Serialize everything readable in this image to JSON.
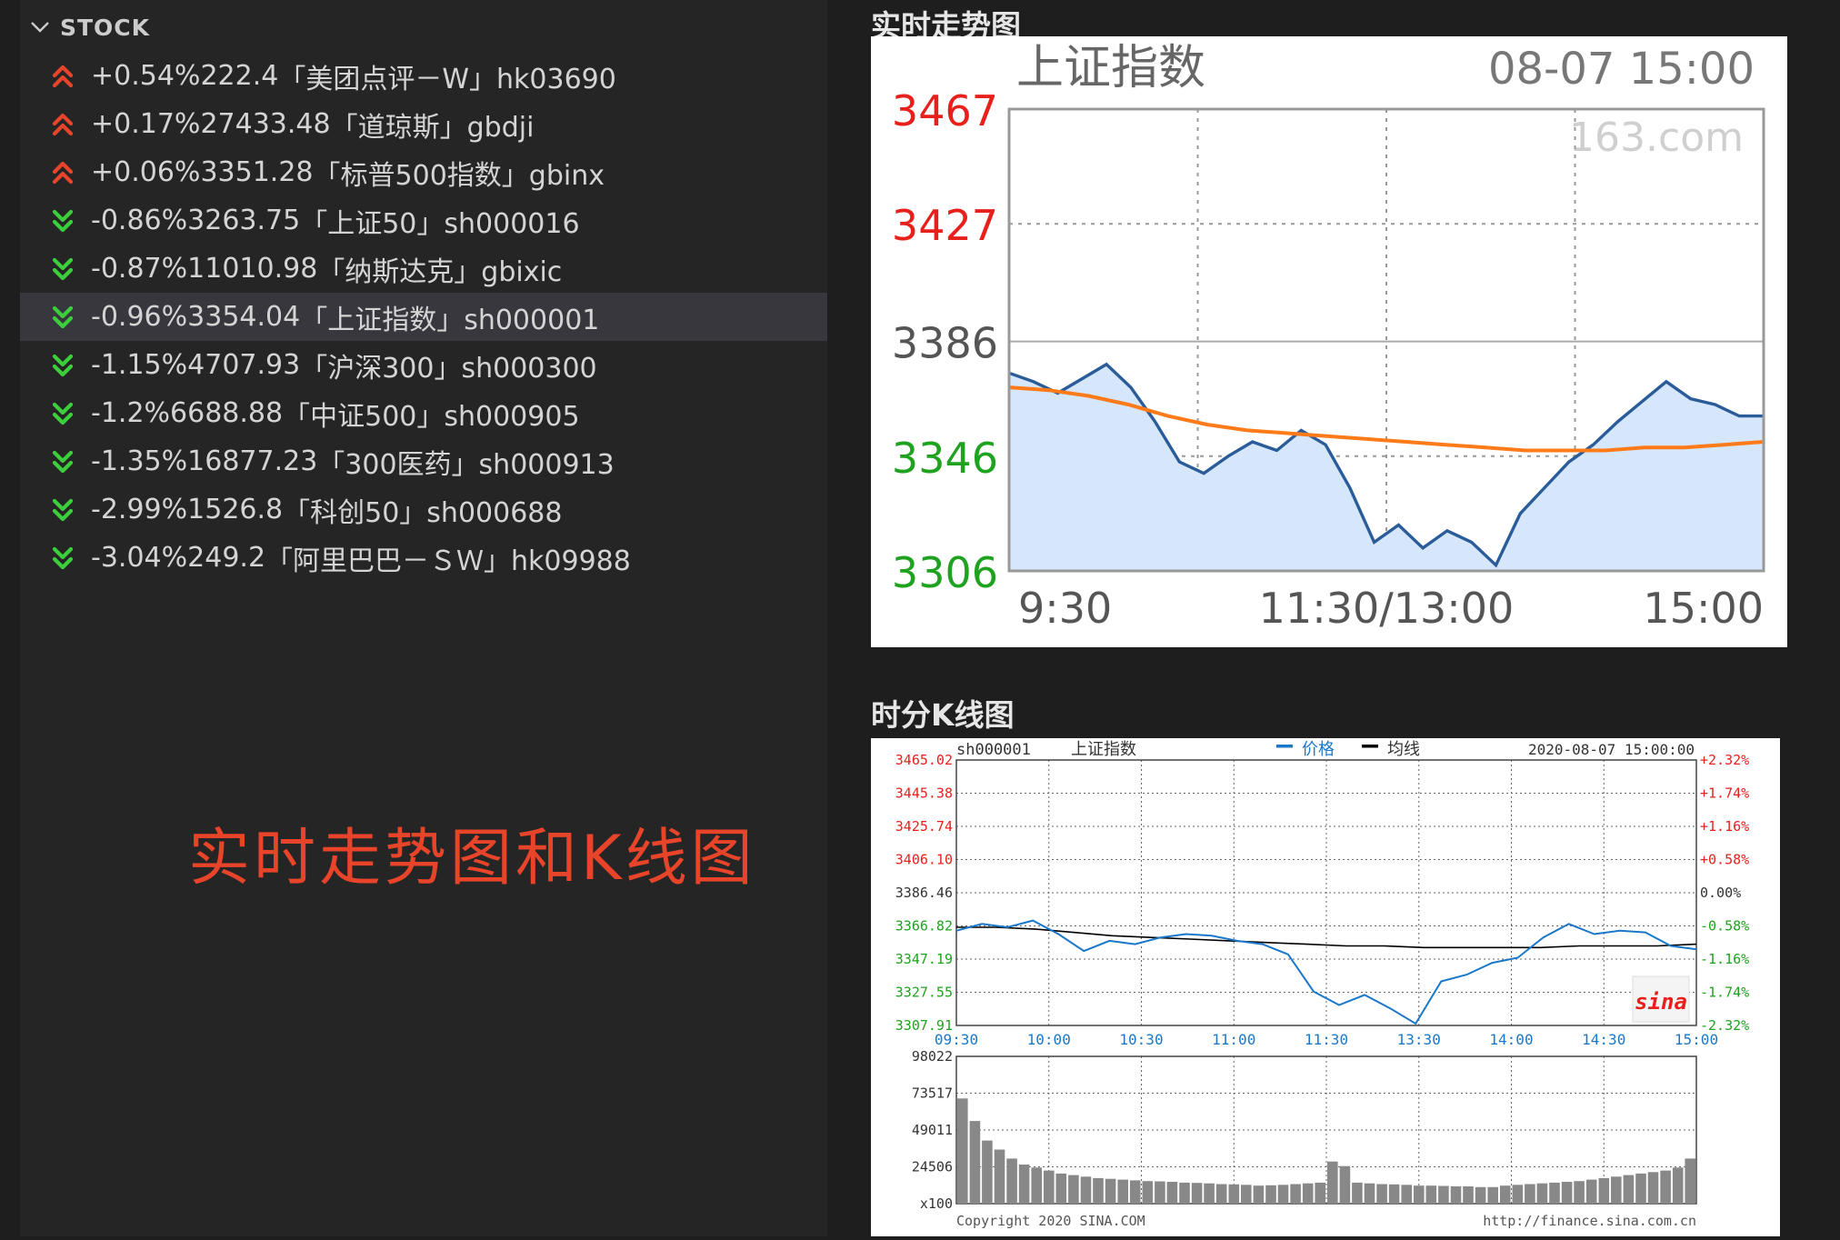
{
  "sidebar": {
    "section_title": "STOCK",
    "stocks": [
      {
        "direction": "up",
        "change": "+0.54%",
        "price": "222.4",
        "name": "「美团点评－W」hk03690"
      },
      {
        "direction": "up",
        "change": "+0.17%",
        "price": "27433.48",
        "name": "「道琼斯」gbdji"
      },
      {
        "direction": "up",
        "change": "+0.06%",
        "price": "3351.28",
        "name": "「标普500指数」gbinx"
      },
      {
        "direction": "down",
        "change": "-0.86%",
        "price": "3263.75",
        "name": "「上证50」sh000016"
      },
      {
        "direction": "down",
        "change": "-0.87%",
        "price": "11010.98",
        "name": "「纳斯达克」gbixic"
      },
      {
        "direction": "down",
        "change": "-0.96%",
        "price": "3354.04",
        "name": "「上证指数」sh000001",
        "selected": true
      },
      {
        "direction": "down",
        "change": "-1.15%",
        "price": "4707.93",
        "name": "「沪深300」sh000300"
      },
      {
        "direction": "down",
        "change": "-1.2%",
        "price": "6688.88",
        "name": "「中证500」sh000905"
      },
      {
        "direction": "down",
        "change": "-1.35%",
        "price": "16877.23",
        "name": "「300医药」sh000913"
      },
      {
        "direction": "down",
        "change": "-2.99%",
        "price": "1526.8",
        "name": "「科创50」sh000688"
      },
      {
        "direction": "down",
        "change": "-3.04%",
        "price": "249.2",
        "name": "「阿里巴巴－ＳＷ」hk09988"
      }
    ]
  },
  "overlay_title": "实时走势图和K线图",
  "colors": {
    "up": "#e8442a",
    "down": "#3ccf3c",
    "accent_red": "#e8442a",
    "grid_orange": "#ff7a18",
    "line_blue": "#2a5c9a",
    "fill_blue": "#d6e6fb"
  },
  "realtime": {
    "title": "实时走势图",
    "index_name": "上证指数",
    "datetime": "08-07 15:00",
    "watermark": "163.com",
    "y_labels": [
      "3467",
      "3427",
      "3386",
      "3346",
      "3306"
    ],
    "x_labels": [
      "9:30",
      "11:30/13:00",
      "15:00"
    ]
  },
  "kline": {
    "title": "时分K线图",
    "code": "sh000001",
    "name": "上证指数",
    "legend_price": "价格",
    "legend_avg": "均线",
    "datetime": "2020-08-07 15:00:00",
    "price_labels": [
      "3465.02",
      "3445.38",
      "3425.74",
      "3406.10",
      "3386.46",
      "3366.82",
      "3347.19",
      "3327.55",
      "3307.91"
    ],
    "pct_labels": [
      "+2.32%",
      "+1.74%",
      "+1.16%",
      "+0.58%",
      "0.00%",
      "-0.58%",
      "-1.16%",
      "-1.74%",
      "-2.32%"
    ],
    "time_labels": [
      "09:30",
      "10:00",
      "10:30",
      "11:00",
      "11:30",
      "13:30",
      "14:00",
      "14:30",
      "15:00"
    ],
    "volume_labels": [
      "98022",
      "73517",
      "49011",
      "24506",
      "x100"
    ],
    "logo": "sina",
    "copyright": "Copyright 2020 SINA.COM",
    "url": "http://finance.sina.com.cn"
  },
  "chart_data": [
    {
      "type": "line",
      "title": "上证指数",
      "x": [
        "9:30",
        "11:30/13:00",
        "15:00"
      ],
      "ylim": [
        3306,
        3467
      ],
      "series": [
        {
          "values": [
            3375,
            3372,
            3368,
            3373,
            3378,
            3370,
            3358,
            3344,
            3340,
            3346,
            3351,
            3348,
            3355,
            3350,
            3335,
            3316,
            3322,
            3314,
            3320,
            3316,
            3308,
            3326,
            3335,
            3344,
            3350,
            3358,
            3365,
            3372,
            3366,
            3364,
            3360,
            3360
          ]
        },
        {
          "values": [
            3370,
            3369,
            3367,
            3364,
            3360,
            3357,
            3355,
            3354,
            3353,
            3352,
            3351,
            3350,
            3349,
            3348,
            3348,
            3348,
            3349,
            3349,
            3350,
            3351
          ]
        }
      ]
    },
    {
      "type": "line",
      "title": "上证指数",
      "x": [
        "09:30",
        "10:00",
        "10:30",
        "11:00",
        "11:30",
        "13:30",
        "14:00",
        "14:30",
        "15:00"
      ],
      "ylim": [
        3307.91,
        3465.02
      ],
      "series": [
        {
          "name": "价格",
          "values": [
            3364,
            3368,
            3366,
            3370,
            3362,
            3352,
            3358,
            3356,
            3360,
            3362,
            3361,
            3358,
            3356,
            3350,
            3328,
            3320,
            3326,
            3318,
            3309,
            3334,
            3338,
            3345,
            3348,
            3360,
            3368,
            3362,
            3364,
            3363,
            3355,
            3353
          ]
        },
        {
          "name": "均线",
          "values": [
            3366,
            3366,
            3365,
            3363,
            3361,
            3360,
            3359,
            3358,
            3357,
            3356,
            3355,
            3355,
            3354,
            3354,
            3354,
            3354,
            3355,
            3355,
            3355,
            3356
          ]
        }
      ]
    },
    {
      "type": "bar",
      "title": "",
      "ylim": [
        0,
        98022
      ],
      "values": [
        70000,
        55000,
        42000,
        36000,
        30000,
        26000,
        24000,
        22000,
        20000,
        19000,
        18000,
        17000,
        16500,
        16000,
        15500,
        15000,
        14800,
        14500,
        14000,
        13800,
        13500,
        13000,
        12800,
        12500,
        12000,
        12200,
        12500,
        13000,
        13500,
        14000,
        28000,
        25000,
        14000,
        13500,
        13000,
        12800,
        12500,
        12000,
        12000,
        11800,
        11500,
        11500,
        11000,
        11000,
        12000,
        12500,
        13000,
        13500,
        14000,
        14500,
        15000,
        16000,
        17000,
        18000,
        19000,
        20000,
        21000,
        22000,
        24000,
        30000
      ]
    }
  ]
}
